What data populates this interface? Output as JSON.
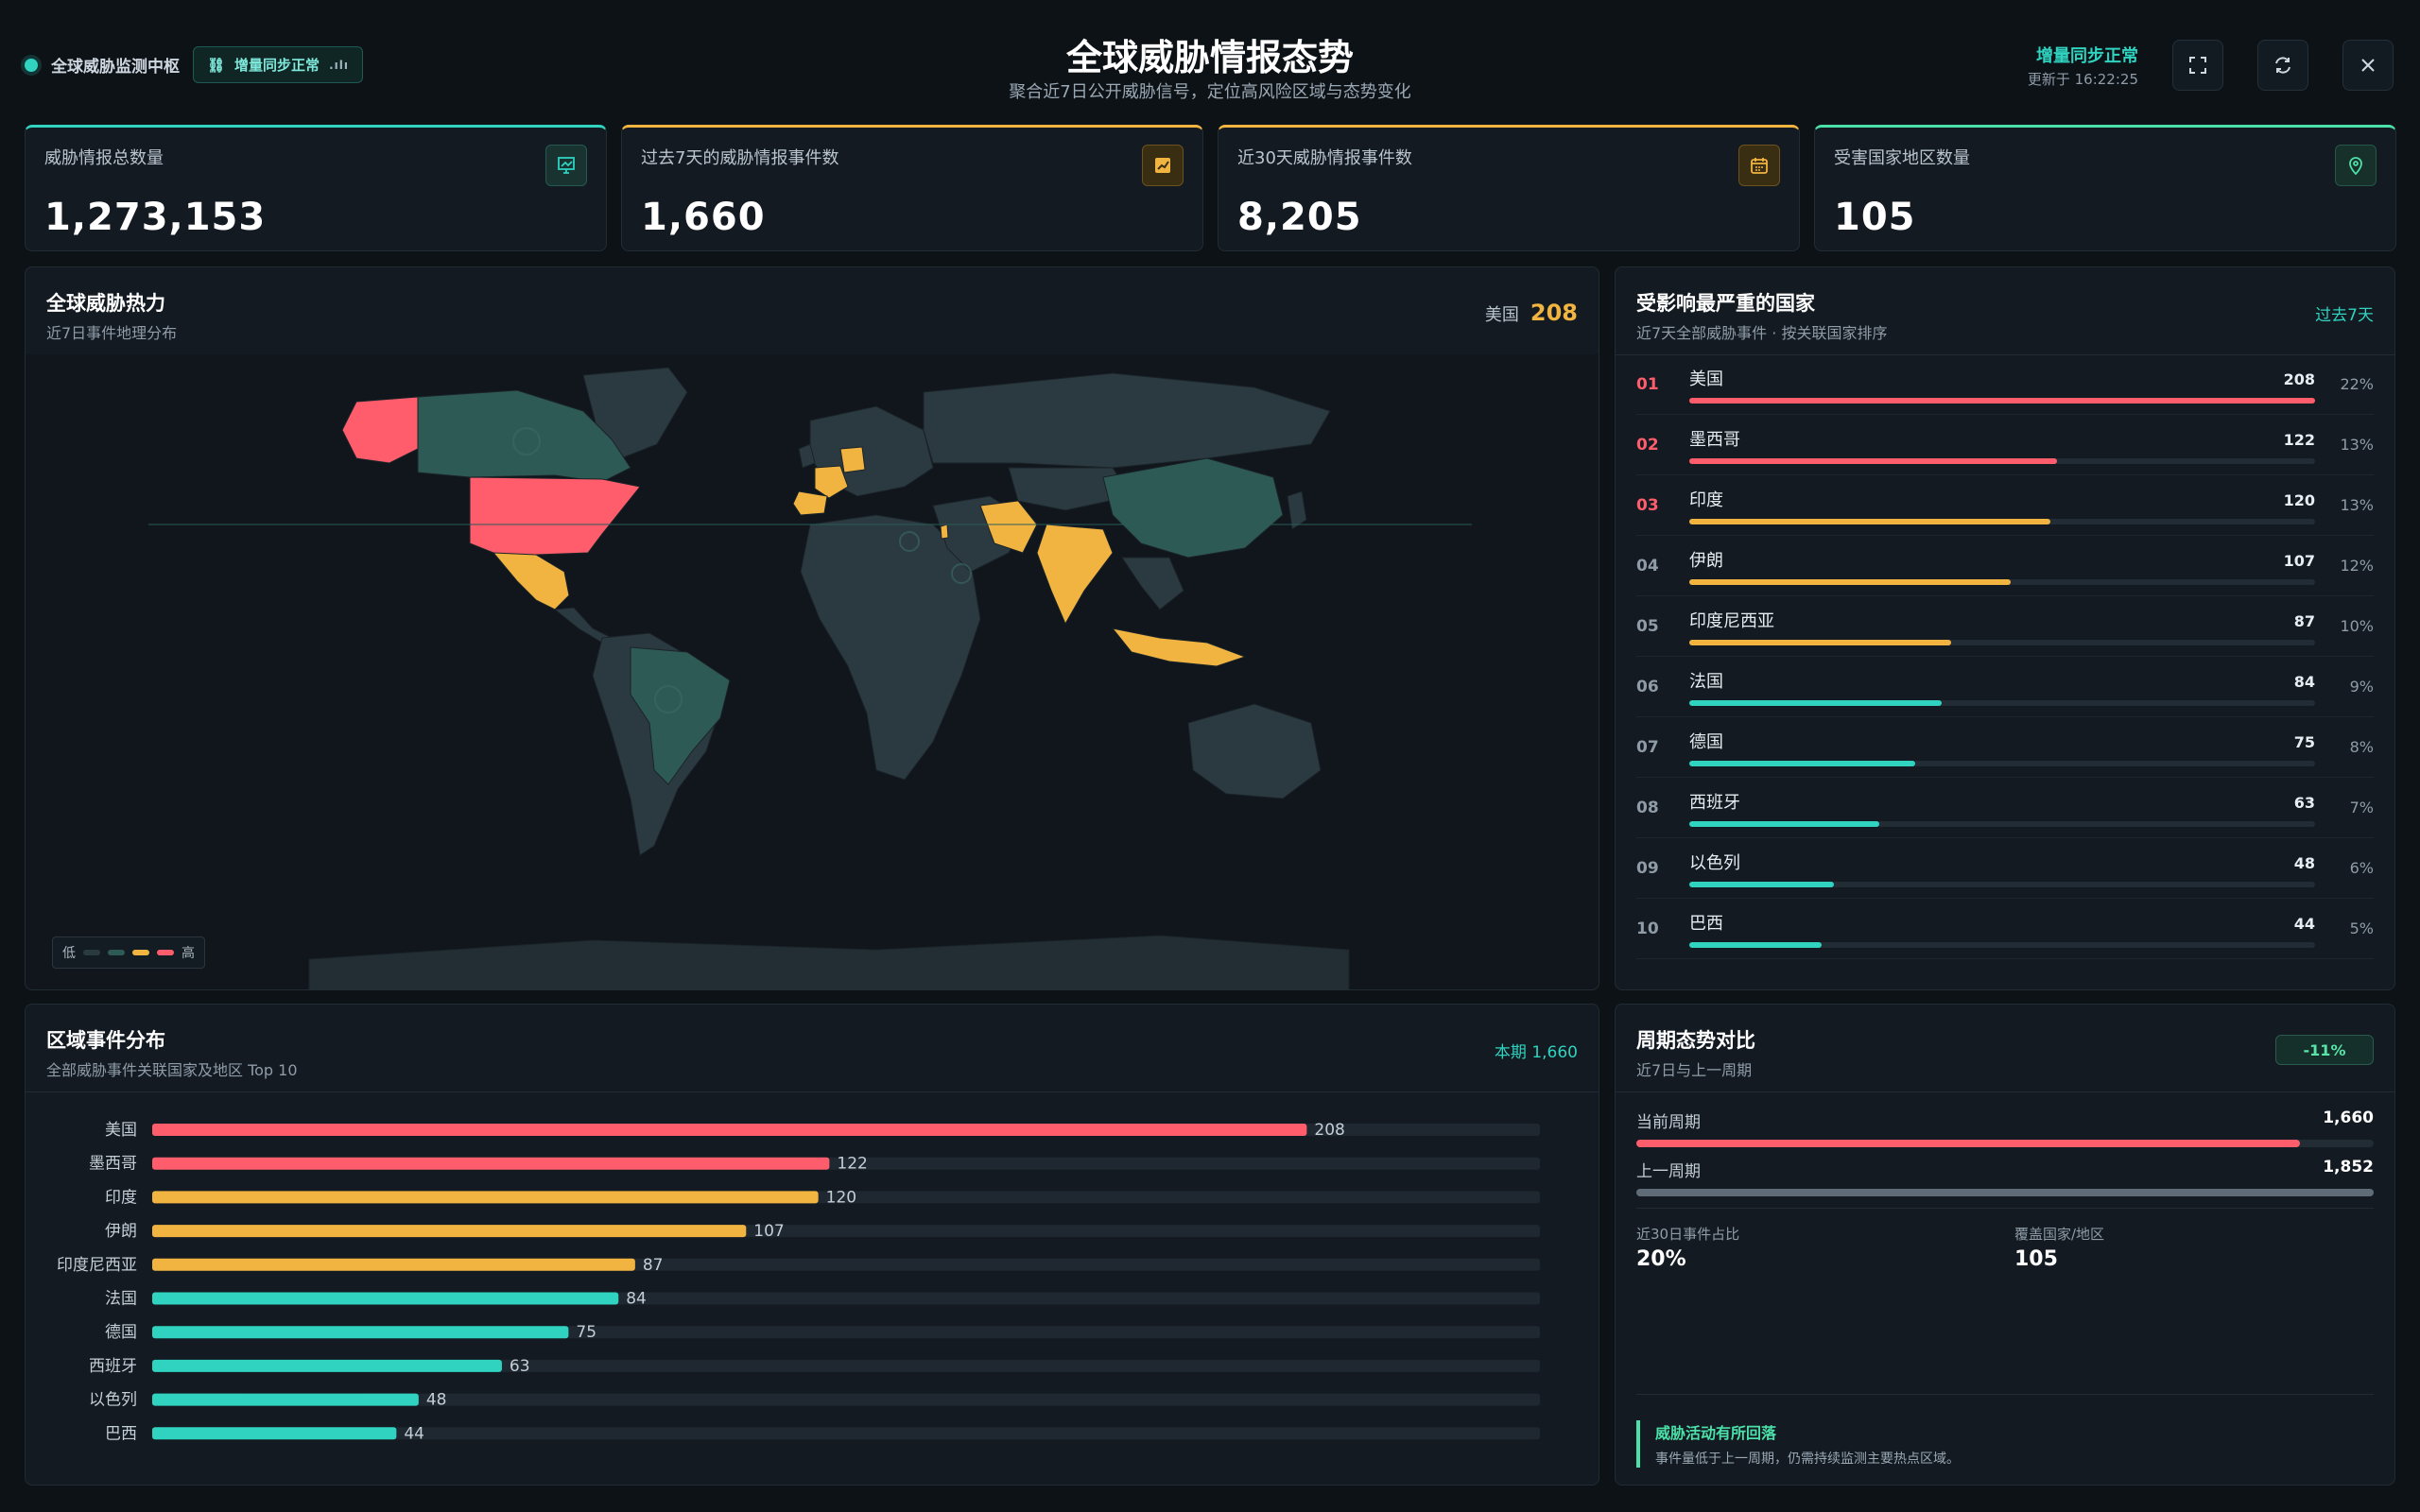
{
  "header": {
    "hub_name": "全球威胁监测中枢",
    "sync_chip": "增量同步正常",
    "sync_chip_icon": "bar-chart-mini-icon",
    "title": "全球威胁情报态势",
    "subtitle": "聚合近7日公开威胁信号，定位高风险区域与态势变化",
    "sync_status": "增量同步正常",
    "updated_at": "更新于 16:22:25"
  },
  "kpis": [
    {
      "label": "威胁情报总数量",
      "value": "1,273,153",
      "icon": "report-icon"
    },
    {
      "label": "过去7天的威胁情报事件数",
      "value": "1,660",
      "icon": "trend-icon"
    },
    {
      "label": "近30天威胁情报事件数",
      "value": "8,205",
      "icon": "calendar-icon"
    },
    {
      "label": "受害国家地区数量",
      "value": "105",
      "icon": "location-icon"
    }
  ],
  "map": {
    "title": "全球威胁热力",
    "subtitle": "近7日事件地理分布",
    "focus_country": "美国",
    "focus_value": "208",
    "legend_low": "低",
    "legend_high": "高"
  },
  "top_countries": {
    "title": "受影响最严重的国家",
    "subtitle": "近7天全部威胁事件 · 按关联国家排序",
    "period_link": "过去7天",
    "rows": [
      {
        "rank": "01",
        "name": "美国",
        "value": "208",
        "pct": "22%",
        "ratio": 1.0
      },
      {
        "rank": "02",
        "name": "墨西哥",
        "value": "122",
        "pct": "13%",
        "ratio": 0.587
      },
      {
        "rank": "03",
        "name": "印度",
        "value": "120",
        "pct": "13%",
        "ratio": 0.577
      },
      {
        "rank": "04",
        "name": "伊朗",
        "value": "107",
        "pct": "12%",
        "ratio": 0.514
      },
      {
        "rank": "05",
        "name": "印度尼西亚",
        "value": "87",
        "pct": "10%",
        "ratio": 0.418
      },
      {
        "rank": "06",
        "name": "法国",
        "value": "84",
        "pct": "9%",
        "ratio": 0.404
      },
      {
        "rank": "07",
        "name": "德国",
        "value": "75",
        "pct": "8%",
        "ratio": 0.361
      },
      {
        "rank": "08",
        "name": "西班牙",
        "value": "63",
        "pct": "7%",
        "ratio": 0.303
      },
      {
        "rank": "09",
        "name": "以色列",
        "value": "48",
        "pct": "6%",
        "ratio": 0.231
      },
      {
        "rank": "10",
        "name": "巴西",
        "value": "44",
        "pct": "5%",
        "ratio": 0.212
      }
    ]
  },
  "distribution": {
    "title": "区域事件分布",
    "subtitle": "全部威胁事件关联国家及地区 Top 10",
    "link": "本期 1,660"
  },
  "chart_data": {
    "type": "bar",
    "orientation": "horizontal",
    "categories": [
      "美国",
      "墨西哥",
      "印度",
      "伊朗",
      "印度尼西亚",
      "法国",
      "德国",
      "西班牙",
      "以色列",
      "巴西"
    ],
    "values": [
      208,
      122,
      120,
      107,
      87,
      84,
      75,
      63,
      48,
      44
    ],
    "xlim": [
      0,
      250
    ]
  },
  "period": {
    "title": "周期态势对比",
    "subtitle": "近7日与上一周期",
    "delta": "-11%",
    "current_label": "当前周期",
    "current_value": "1,660",
    "current_ratio": 0.9,
    "prev_label": "上一周期",
    "prev_value": "1,852",
    "prev_ratio": 1.0,
    "share_label": "近30日事件占比",
    "share_value": "20%",
    "coverage_label": "覆盖国家/地区",
    "coverage_value": "105",
    "note_title": "威胁活动有所回落",
    "note_desc": "事件量低于上一周期，仍需持续监测主要热点区域。"
  },
  "colors": {
    "teal": "#2fd3c0",
    "amber": "#f2b441",
    "red": "#ff5d6c",
    "map_base": "#2b3a40",
    "map_mid": "#2e5a56"
  }
}
